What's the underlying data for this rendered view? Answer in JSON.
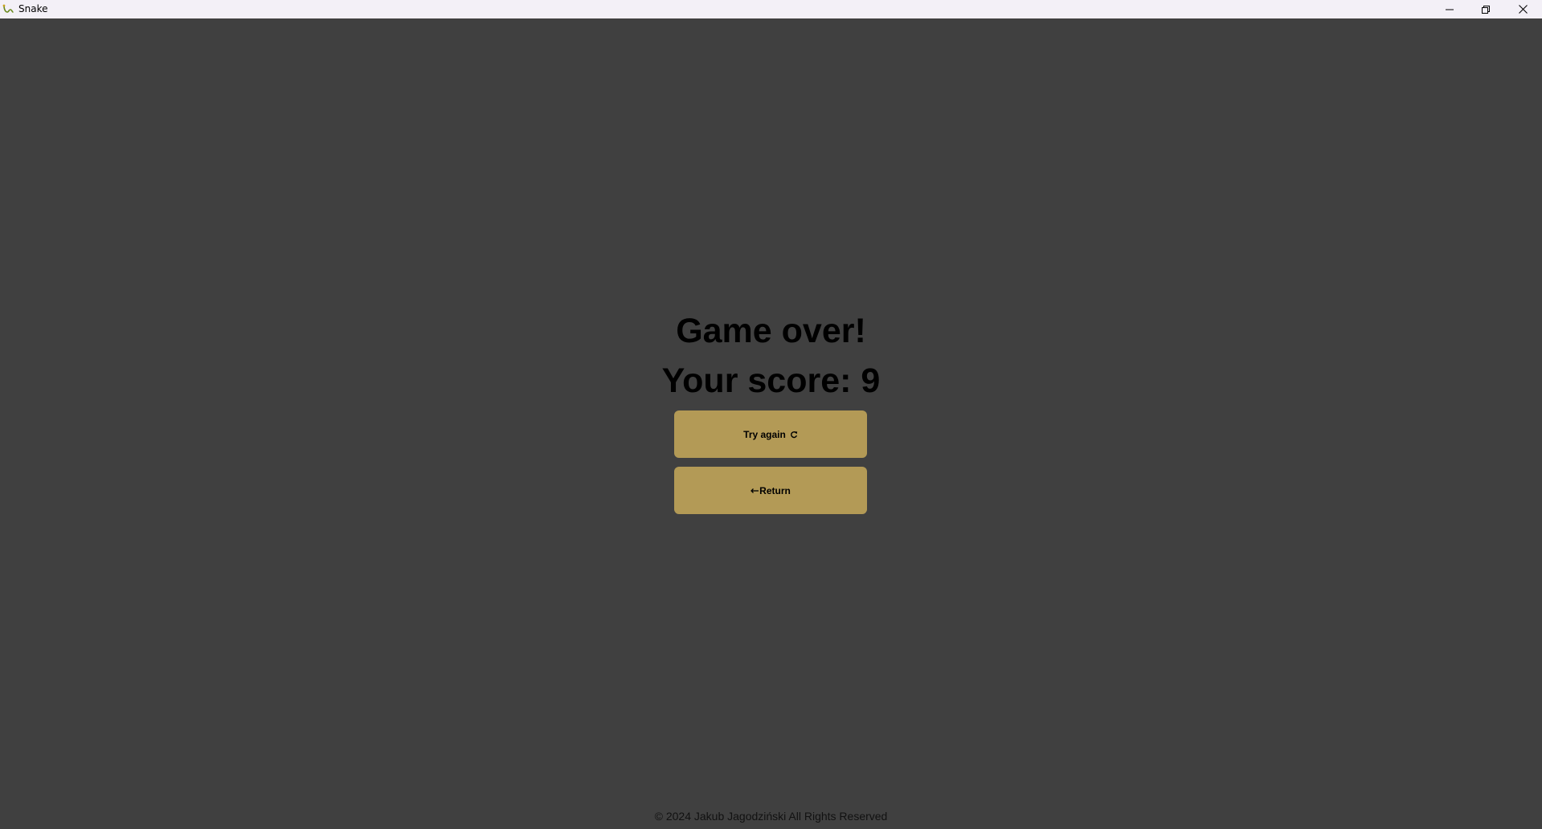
{
  "window": {
    "title": "Snake",
    "icon": "snake-app-icon",
    "controls": [
      "minimize-icon",
      "restore-icon",
      "close-icon"
    ]
  },
  "game_over": {
    "title": "Game over!",
    "score_text": "Your score: 9",
    "score": 9
  },
  "buttons": {
    "try_again_label": "Try again",
    "try_again_icon": "refresh-icon",
    "return_label": "Return",
    "return_icon": "arrow-left-icon"
  },
  "footer": {
    "copyright": "© 2024 Jakub Jagodziński All Rights Reserved"
  },
  "colors": {
    "background": "#404040",
    "titlebar": "#f3f0f7",
    "button": "#b39a56",
    "text": "#000000"
  }
}
